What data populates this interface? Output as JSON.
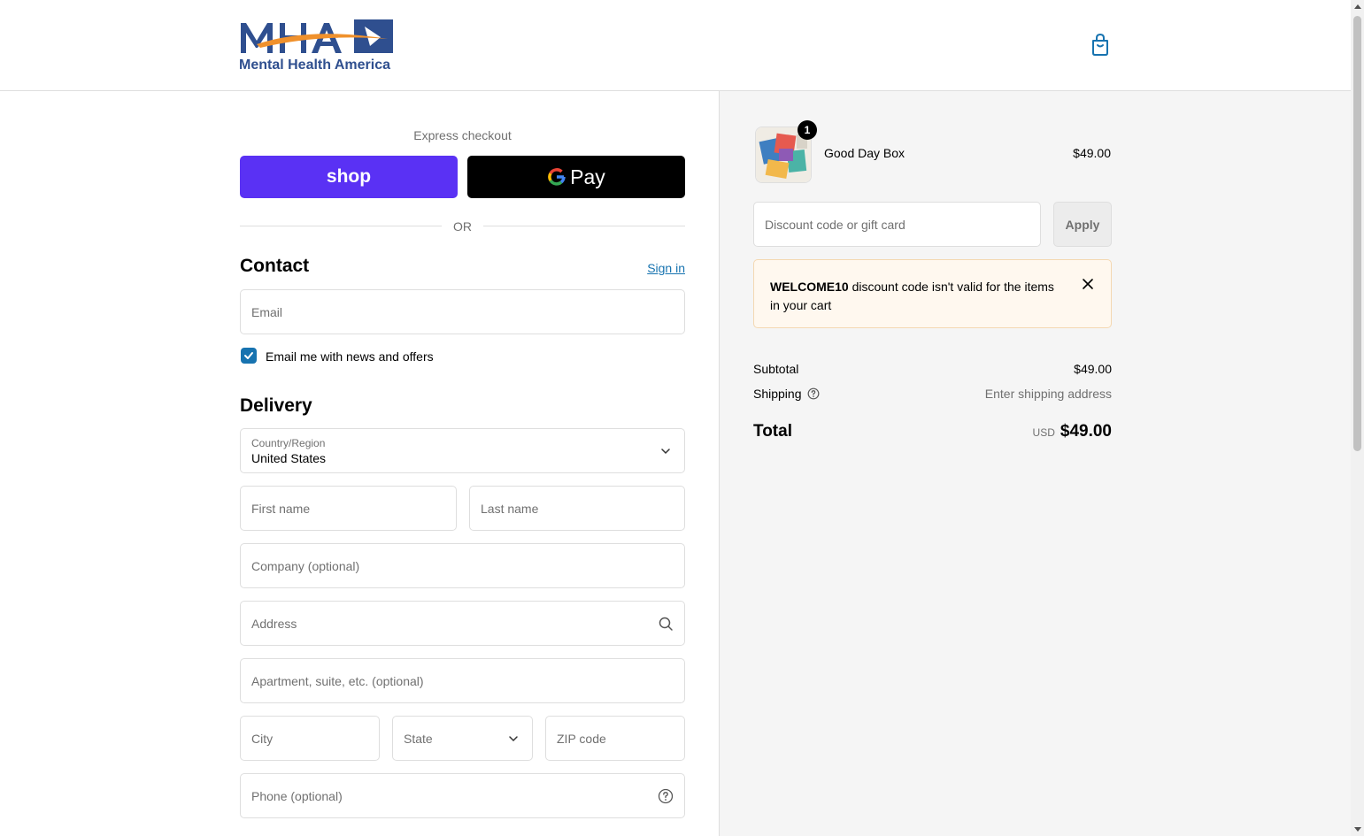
{
  "header": {
    "logo_text": "MHA",
    "logo_subtitle": "Mental Health America"
  },
  "express": {
    "label": "Express checkout",
    "shop_label": "shop",
    "gpay_label": "Pay",
    "or_label": "OR"
  },
  "contact": {
    "title": "Contact",
    "signin_label": "Sign in",
    "email_placeholder": "Email",
    "newsletter_label": "Email me with news and offers",
    "newsletter_checked": true
  },
  "delivery": {
    "title": "Delivery",
    "country_label": "Country/Region",
    "country_value": "United States",
    "first_name_placeholder": "First name",
    "last_name_placeholder": "Last name",
    "company_placeholder": "Company (optional)",
    "address_placeholder": "Address",
    "apartment_placeholder": "Apartment, suite, etc. (optional)",
    "city_placeholder": "City",
    "state_placeholder": "State",
    "zip_placeholder": "ZIP code",
    "phone_placeholder": "Phone (optional)"
  },
  "order": {
    "item_name": "Good Day Box",
    "item_price": "$49.00",
    "item_qty": "1",
    "discount_placeholder": "Discount code or gift card",
    "apply_label": "Apply",
    "alert_code": "WELCOME10",
    "alert_message": " discount code isn't valid for the items in your cart",
    "subtotal_label": "Subtotal",
    "subtotal_value": "$49.00",
    "shipping_label": "Shipping",
    "shipping_value": "Enter shipping address",
    "total_label": "Total",
    "total_currency": "USD",
    "total_value": "$49.00"
  },
  "colors": {
    "shop_purple": "#5a31f4",
    "link_blue": "#1773b0",
    "alert_bg": "#fff8ef",
    "logo_blue": "#2f4f8f",
    "logo_orange": "#f0912c"
  }
}
